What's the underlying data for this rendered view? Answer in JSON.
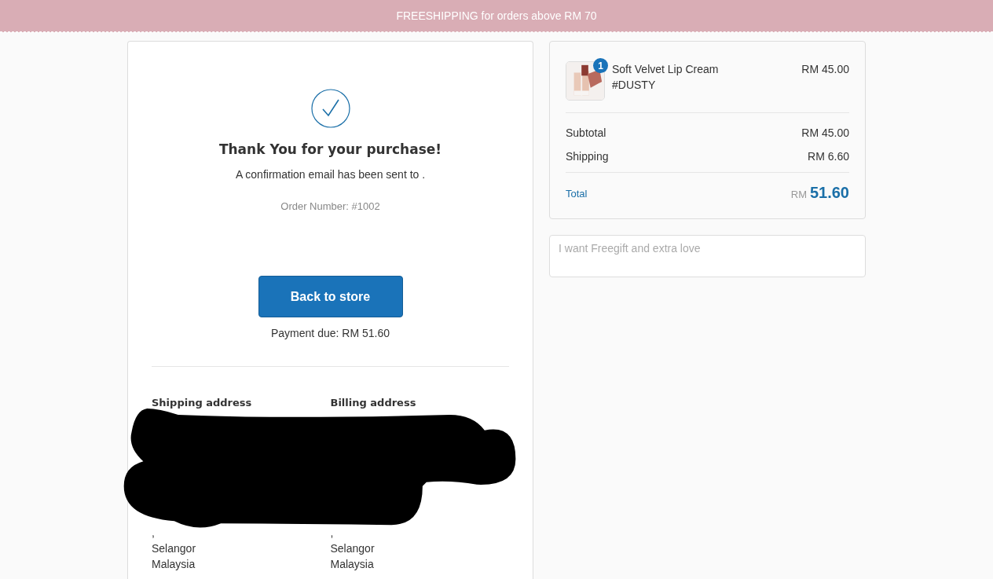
{
  "banner": {
    "text": "FREESHIPPING for orders above RM 70"
  },
  "confirmation": {
    "title": "Thank You for your purchase!",
    "message": "A confirmation email has been sent to .",
    "order_number": "Order Number: #1002",
    "button": "Back to store",
    "payment_due": "Payment due: RM 51.60"
  },
  "addresses": [
    {
      "heading": "Shipping address",
      "lines": [
        ",",
        "Selangor",
        "Malaysia"
      ]
    },
    {
      "heading": "Billing address",
      "lines": [
        ",",
        "Selangor",
        "Malaysia"
      ]
    }
  ],
  "order_summary": {
    "items": [
      {
        "name": "Soft Velvet Lip Cream",
        "variant": "#DUSTY",
        "quantity": "1",
        "price": "RM 45.00"
      }
    ],
    "subtotal": {
      "label": "Subtotal",
      "value": "RM 45.00"
    },
    "shipping": {
      "label": "Shipping",
      "value": "RM 6.60"
    },
    "total": {
      "label": "Total",
      "currency": "RM",
      "value": "51.60"
    }
  },
  "note": {
    "placeholder": "I want Freegift and extra love"
  }
}
